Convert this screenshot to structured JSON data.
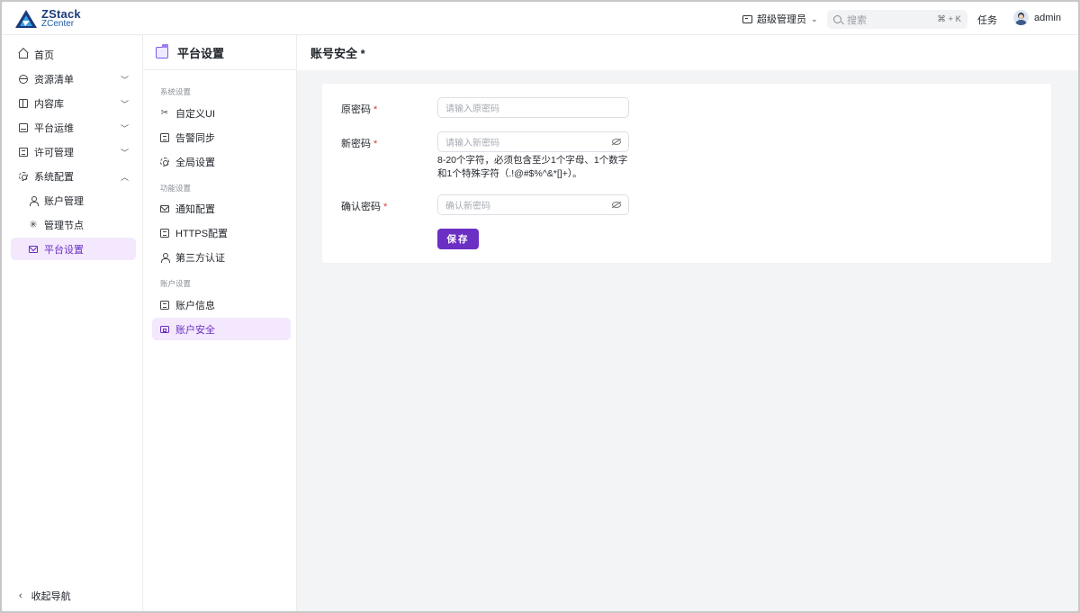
{
  "brand": {
    "name": "ZStack",
    "product": "ZCenter"
  },
  "header": {
    "role": "超级管理员",
    "search_placeholder": "搜索",
    "search_shortcut": "⌘ + K",
    "tasks": "任务",
    "username": "admin"
  },
  "leftnav": {
    "items": [
      {
        "label": "首页",
        "icon": "home-icon"
      },
      {
        "label": "资源清单",
        "icon": "globe-icon"
      },
      {
        "label": "内容库",
        "icon": "box-icon"
      },
      {
        "label": "平台运维",
        "icon": "tray-icon"
      },
      {
        "label": "许可管理",
        "icon": "doc-icon"
      },
      {
        "label": "系统配置",
        "icon": "gear-icon"
      }
    ],
    "sub_items": [
      {
        "label": "账户管理",
        "icon": "person-icon"
      },
      {
        "label": "管理节点",
        "icon": "spark-icon"
      },
      {
        "label": "平台设置",
        "icon": "mail-icon"
      }
    ],
    "collapse": "收起导航"
  },
  "secnav": {
    "title": "平台设置",
    "groups": [
      {
        "title": "系统设置",
        "items": [
          "自定义UI",
          "告警同步",
          "全局设置"
        ]
      },
      {
        "title": "功能设置",
        "items": [
          "通知配置",
          "HTTPS配置",
          "第三方认证"
        ]
      },
      {
        "title": "账户设置",
        "items": [
          "账户信息",
          "账户安全"
        ]
      }
    ]
  },
  "main": {
    "title": "账号安全 *",
    "form": {
      "old_password": {
        "label": "原密码",
        "placeholder": "请输入原密码"
      },
      "new_password": {
        "label": "新密码",
        "placeholder": "请输入新密码"
      },
      "hint": "8-20个字符，必须包含至少1个字母、1个数字和1个特殊字符（.!@#$%^&*[]+）。",
      "confirm_password": {
        "label": "确认密码",
        "placeholder": "确认新密码"
      },
      "required_mark": "*",
      "save": "保存"
    }
  },
  "colors": {
    "accent": "#6b2fc4",
    "active_bg": "#f3e8fd",
    "main_bg": "#f3f4f6",
    "required": "#d23b3b"
  }
}
